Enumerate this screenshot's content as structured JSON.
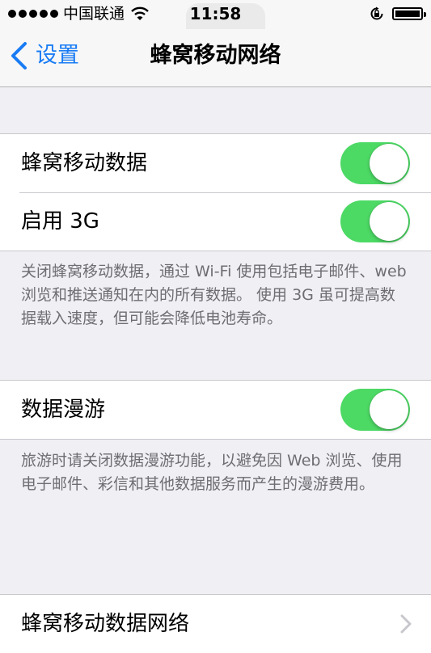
{
  "status_bar": {
    "carrier": "中国联通",
    "time": "11:58"
  },
  "nav": {
    "back_label": "设置",
    "title": "蜂窝移动网络"
  },
  "group1": {
    "rows": [
      {
        "label": "蜂窝移动数据",
        "toggle": "on"
      },
      {
        "label": "启用 3G",
        "toggle": "on"
      }
    ],
    "footer": "关闭蜂窝移动数据，通过 Wi-Fi 使用包括电子邮件、web 浏览和推送通知在内的所有数据。 使用 3G 虽可提高数据载入速度，但可能会降低电池寿命。"
  },
  "group2": {
    "rows": [
      {
        "label": "数据漫游",
        "toggle": "on"
      }
    ],
    "footer": "旅游时请关闭数据漫游功能，以避免因 Web 浏览、使用电子邮件、彩信和其他数据服务而产生的漫游费用。"
  },
  "group3": {
    "rows": [
      {
        "label": "蜂窝移动数据网络"
      }
    ]
  },
  "colors": {
    "accent": "#1a7cf4",
    "toggle_on": "#4cd964",
    "background": "#efeff4"
  }
}
